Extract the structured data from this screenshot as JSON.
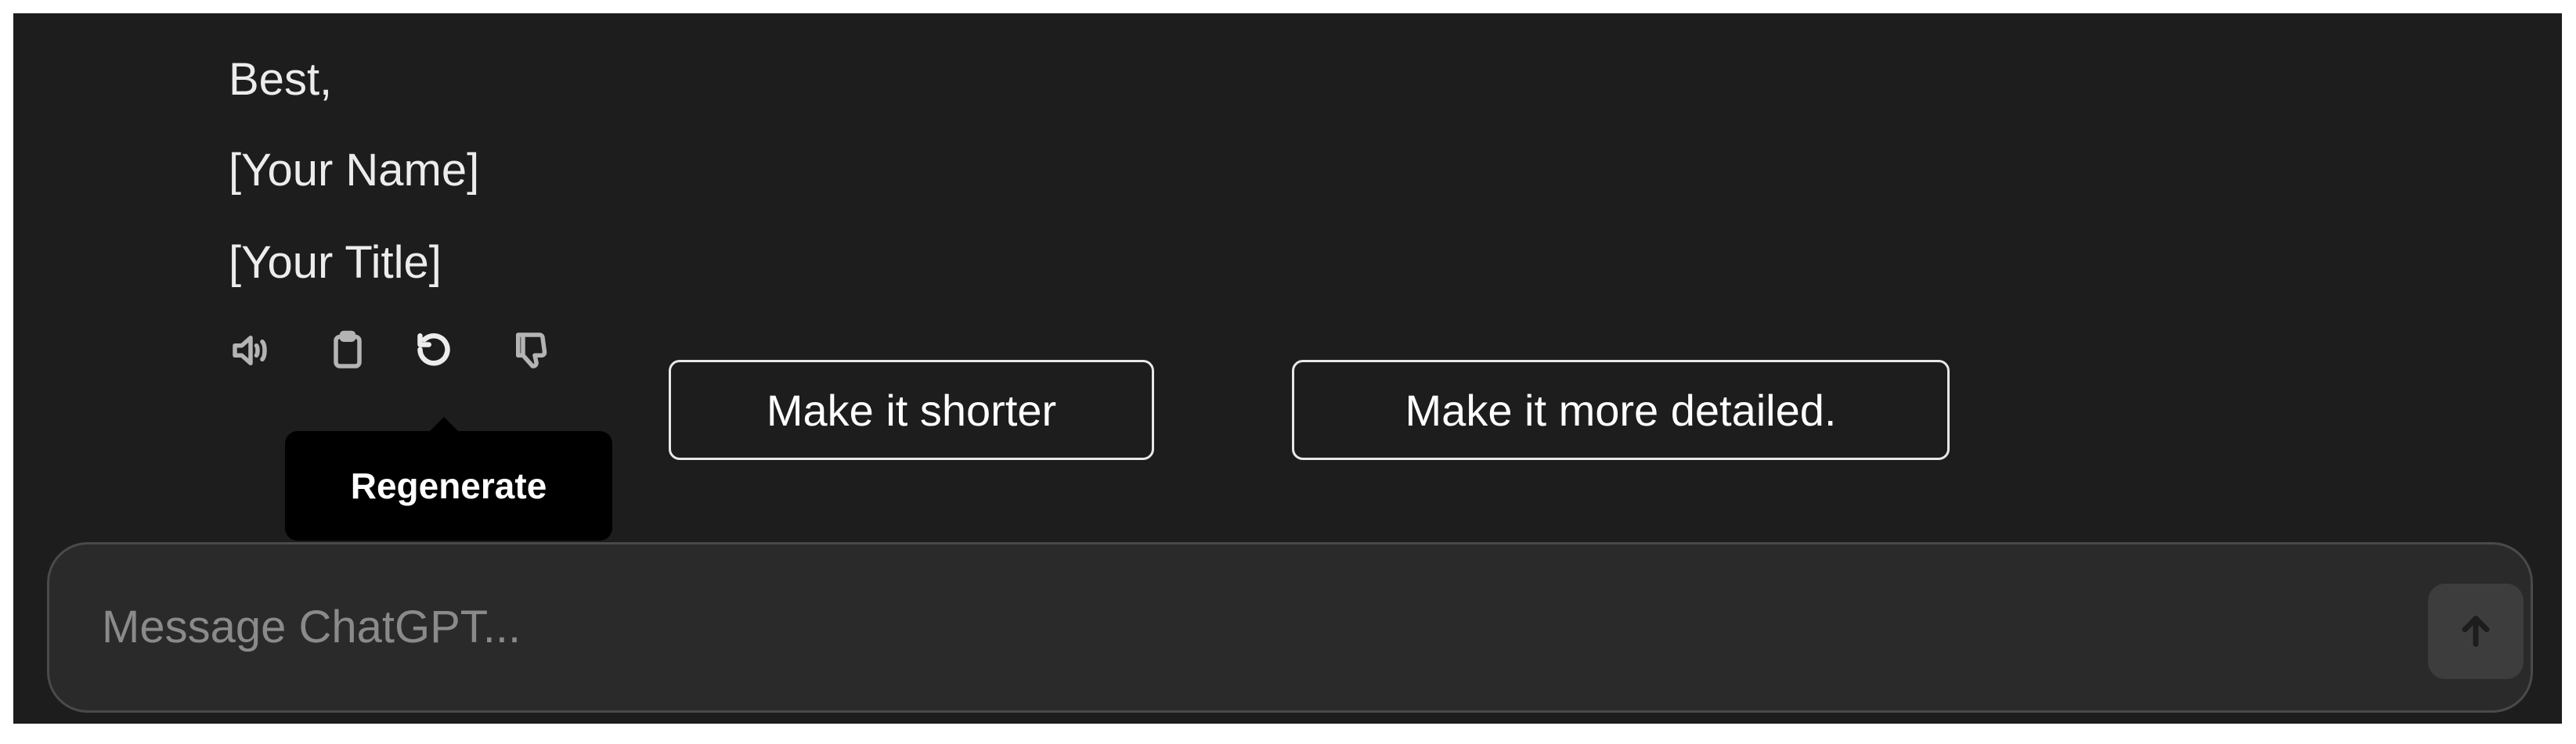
{
  "message": {
    "lines": [
      "Best,",
      "[Your Name]",
      "[Your Title]"
    ]
  },
  "actions": [
    {
      "icon": "speaker-icon"
    },
    {
      "icon": "clipboard-icon"
    },
    {
      "icon": "regenerate-icon"
    },
    {
      "icon": "thumbs-down-icon"
    }
  ],
  "tooltip": {
    "label": "Regenerate"
  },
  "suggestions": [
    "Make it shorter",
    "Make it more detailed."
  ],
  "composer": {
    "placeholder": "Message ChatGPT...",
    "send_icon": "arrow-up-icon"
  },
  "colors": {
    "background": "#1d1d1d",
    "text": "#ececec",
    "tooltip_bg": "#000000",
    "composer_border": "#4a4a4a"
  }
}
